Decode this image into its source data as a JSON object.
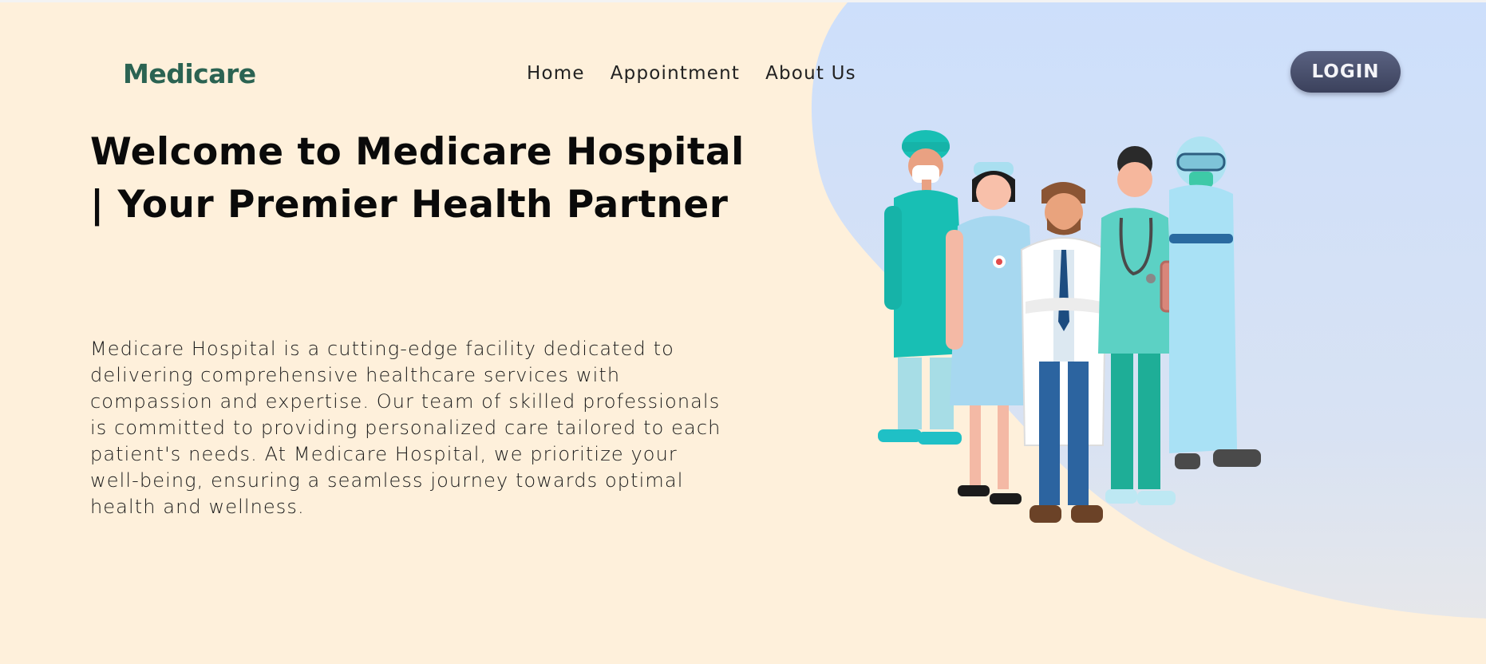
{
  "brand": {
    "logo_text": "Medicare",
    "color": "#2b6352"
  },
  "nav": {
    "links": [
      {
        "label": "Home"
      },
      {
        "label": "Appointment"
      },
      {
        "label": "About Us"
      }
    ],
    "login_label": "LOGIN"
  },
  "hero": {
    "title": "Welcome to Medicare Hospital | Your Premier Health Partner",
    "description": "Medicare Hospital is a cutting-edge facility dedicated to delivering comprehensive healthcare services with compassion and expertise. Our team of skilled professionals is committed to providing personalized care tailored to each patient's needs. At Medicare Hospital, we prioritize your well-being, ensuring a seamless journey towards optimal health and wellness."
  },
  "colors": {
    "background": "#fef0db",
    "blob": "#cfdffa",
    "button": "#474d69",
    "text": "#0a0a0a"
  },
  "illustration": {
    "subject": "medical-team-illustration"
  }
}
